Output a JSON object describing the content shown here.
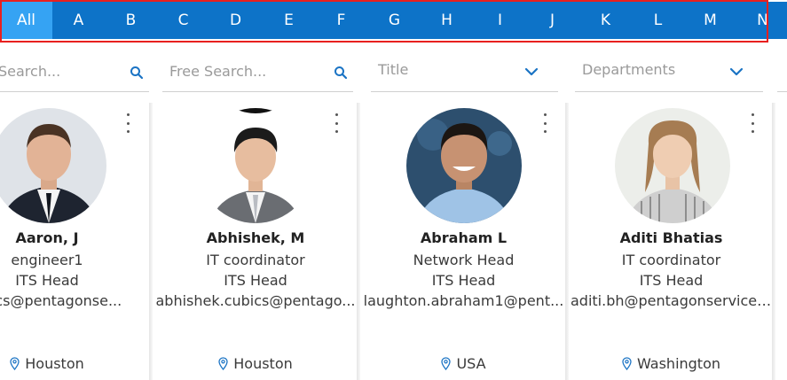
{
  "alphabet": [
    "All",
    "A",
    "B",
    "C",
    "D",
    "E",
    "F",
    "G",
    "H",
    "I",
    "J",
    "K",
    "L",
    "M",
    "N"
  ],
  "alphabet_active": "All",
  "filters": {
    "search_placeholder": "Search...",
    "free_search_placeholder": "Free Search...",
    "title_placeholder": "Title",
    "departments_placeholder": "Departments"
  },
  "colors": {
    "alphabet_bar": "#0d73c8",
    "alphabet_active": "#35a3f3",
    "highlight_border": "#e8201f",
    "icon_accent": "#1a73c4"
  },
  "cards": [
    {
      "name": "Aaron, J",
      "role": "engineer1",
      "department": "ITS Head",
      "email": "cubics@pentagonse...",
      "location": "Houston"
    },
    {
      "name": "Abhishek, M",
      "role": "IT coordinator",
      "department": "ITS Head",
      "email": "abhishek.cubics@pentago...",
      "location": "Houston"
    },
    {
      "name": "Abraham L",
      "role": "Network Head",
      "department": "ITS Head",
      "email": "laughton.abraham1@pent...",
      "location": "USA"
    },
    {
      "name": "Aditi Bhatias",
      "role": "IT coordinator",
      "department": "ITS Head",
      "email": "aditi.bh@pentagonservices...",
      "location": "Washington"
    }
  ]
}
